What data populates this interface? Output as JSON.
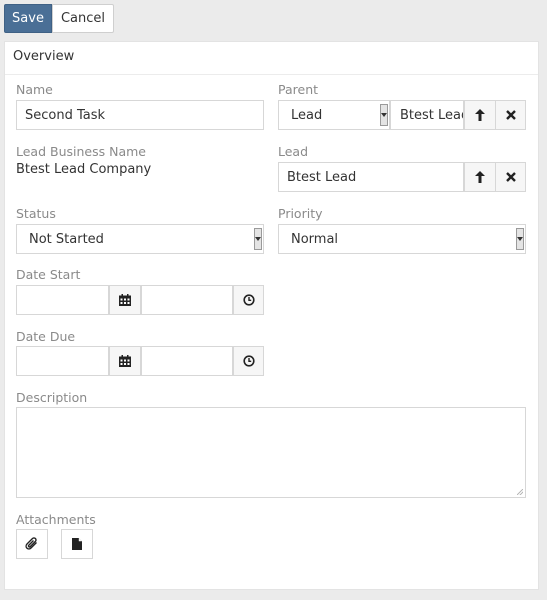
{
  "toolbar": {
    "save_label": "Save",
    "cancel_label": "Cancel"
  },
  "panel": {
    "title": "Overview"
  },
  "fields": {
    "name": {
      "label": "Name",
      "value": "Second Task"
    },
    "parent": {
      "label": "Parent",
      "type_value": "Lead",
      "record_value": "Btest Lead"
    },
    "lead_business_name": {
      "label": "Lead Business Name",
      "value": "Btest Lead Company"
    },
    "lead": {
      "label": "Lead",
      "value": "Btest Lead"
    },
    "status": {
      "label": "Status",
      "value": "Not Started"
    },
    "priority": {
      "label": "Priority",
      "value": "Normal"
    },
    "date_start": {
      "label": "Date Start",
      "date_value": "",
      "time_value": ""
    },
    "date_due": {
      "label": "Date Due",
      "date_value": "",
      "time_value": ""
    },
    "description": {
      "label": "Description",
      "value": ""
    },
    "attachments": {
      "label": "Attachments"
    }
  },
  "icons": {
    "select": "arrow-up-icon",
    "clear": "x-icon",
    "calendar": "calendar-icon",
    "clock": "clock-icon",
    "attach": "paperclip-icon",
    "document": "document-icon"
  },
  "colors": {
    "primary_button": "#4a6f96",
    "page_background": "#ebebeb"
  }
}
